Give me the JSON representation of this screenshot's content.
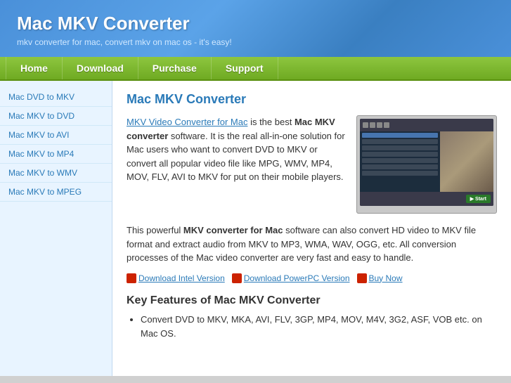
{
  "header": {
    "title": "Mac MKV Converter",
    "subtitle": "mkv converter for mac, convert mkv on mac os - it's easy!"
  },
  "nav": {
    "items": [
      {
        "label": "Home",
        "id": "home"
      },
      {
        "label": "Download",
        "id": "download"
      },
      {
        "label": "Purchase",
        "id": "purchase"
      },
      {
        "label": "Support",
        "id": "support"
      }
    ]
  },
  "sidebar": {
    "links": [
      {
        "label": "Mac DVD to MKV",
        "id": "mac-dvd-to-mkv"
      },
      {
        "label": "Mac MKV to DVD",
        "id": "mac-mkv-to-dvd"
      },
      {
        "label": "Mac MKV to AVI",
        "id": "mac-mkv-to-avi"
      },
      {
        "label": "Mac MKV to MP4",
        "id": "mac-mkv-to-mp4"
      },
      {
        "label": "Mac MKV to WMV",
        "id": "mac-mkv-to-wmv"
      },
      {
        "label": "Mac MKV to MPEG",
        "id": "mac-mkv-to-mpeg"
      }
    ]
  },
  "content": {
    "page_title": "Mac MKV Converter",
    "product_link_text": "MKV Video Converter for Mac",
    "intro_text_1": " is the best ",
    "intro_bold_1": "Mac MKV converter",
    "intro_text_2": " software. It is the real all-in-one solution for Mac users who want to convert DVD to MKV or convert all popular video file like MPG, WMV, MP4, MOV, FLV, AVI to MKV for put on their mobile players.",
    "desc_para": "This powerful MKV converter for Mac software can also convert HD video to MKV file format and extract audio from MKV to MP3, WMA, WAV, OGG, etc. All conversion processes of the Mac video converter are very fast and easy to handle.",
    "download_intel_label": "Download Intel Version",
    "download_powerpc_label": "Download PowerPC Version",
    "buy_now_label": "Buy Now",
    "features_title": "Key Features of Mac MKV Converter",
    "features": [
      "Convert DVD to MKV, MKA, AVI, FLV, 3GP, MP4, MOV, M4V, 3G2, ASF, VOB etc. on Mac OS."
    ]
  }
}
